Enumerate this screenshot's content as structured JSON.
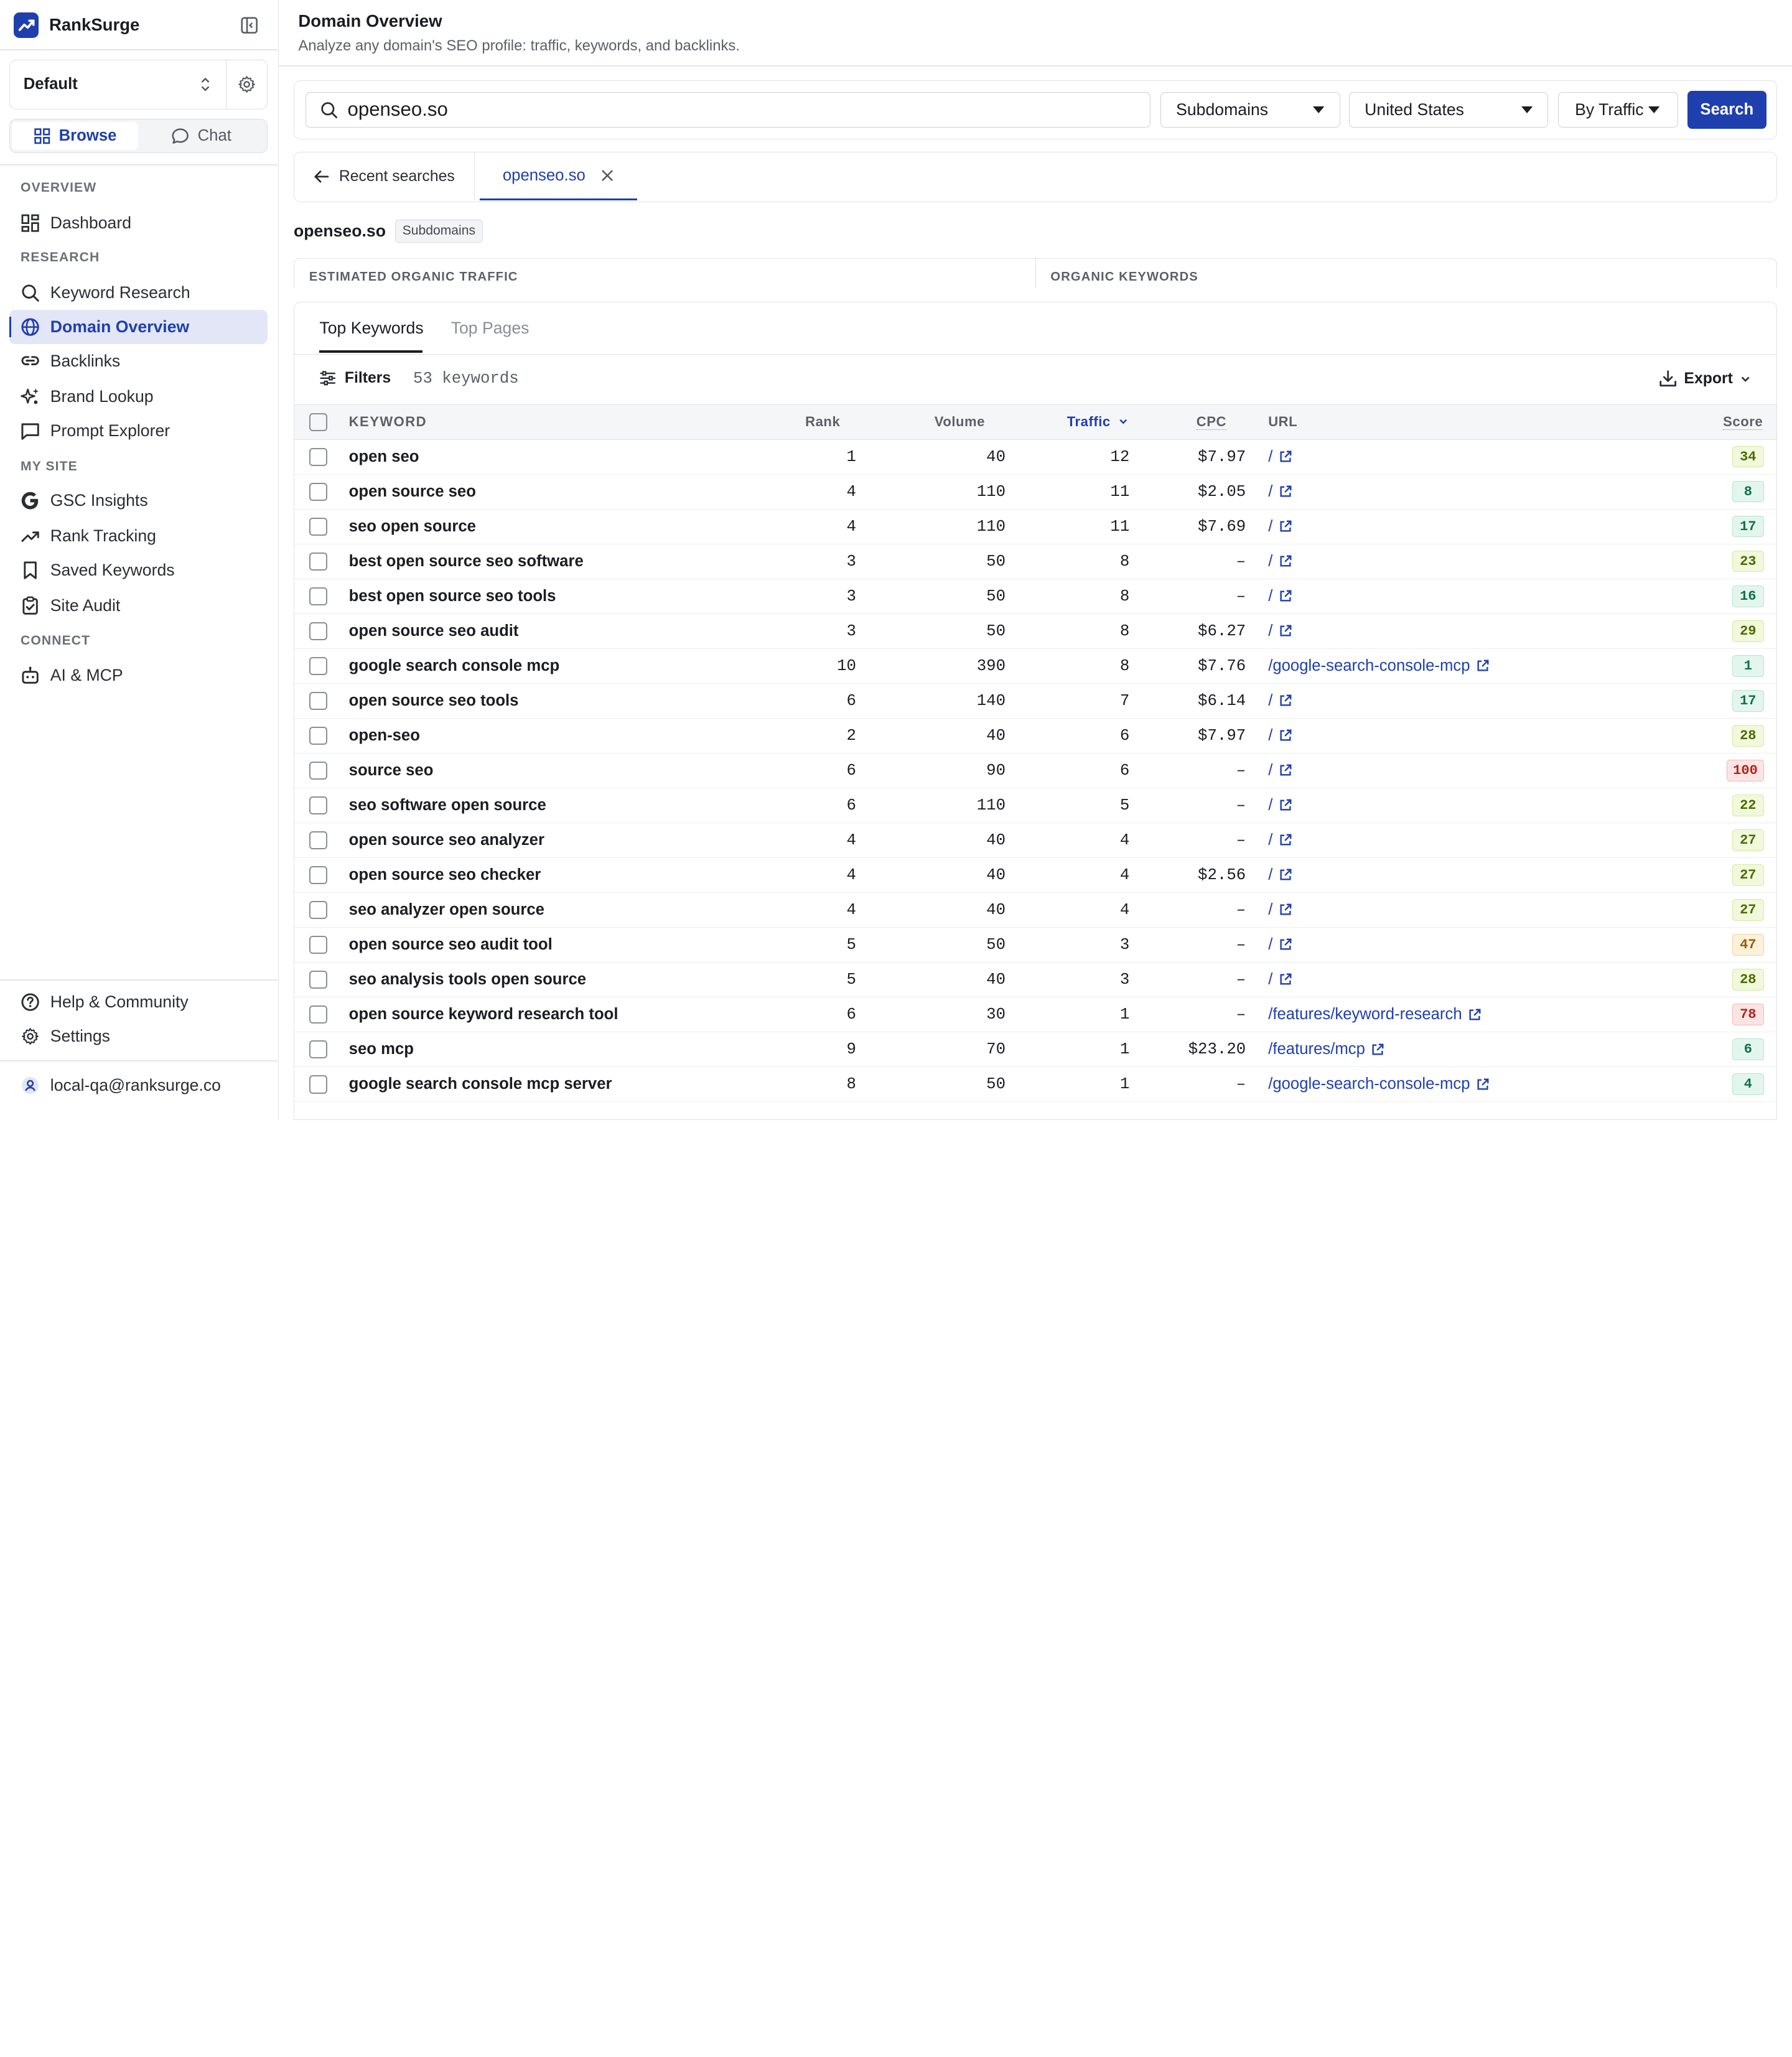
{
  "brand": {
    "name": "RankSurge"
  },
  "project": {
    "selected": "Default"
  },
  "mode_toggle": {
    "browse": "Browse",
    "chat": "Chat"
  },
  "sidebar": {
    "sections": {
      "overview": "OVERVIEW",
      "research": "RESEARCH",
      "my_site": "MY SITE",
      "connect": "CONNECT"
    },
    "items": {
      "dashboard": "Dashboard",
      "keyword_research": "Keyword Research",
      "domain_overview": "Domain Overview",
      "backlinks": "Backlinks",
      "brand_lookup": "Brand Lookup",
      "prompt_explorer": "Prompt Explorer",
      "gsc_insights": "GSC Insights",
      "rank_tracking": "Rank Tracking",
      "saved_keywords": "Saved Keywords",
      "site_audit": "Site Audit",
      "ai_mcp": "AI & MCP",
      "help": "Help & Community",
      "settings": "Settings"
    },
    "user_email": "local-qa@ranksurge.co"
  },
  "header": {
    "title": "Domain Overview",
    "subtitle": "Analyze any domain's SEO profile: traffic, keywords, and backlinks."
  },
  "search": {
    "value": "openseo.so",
    "scope": "Subdomains",
    "country": "United States",
    "sort": "By Traffic",
    "button": "Search"
  },
  "tabs": {
    "recent": "Recent searches",
    "active_domain": "openseo.so"
  },
  "domain_label": {
    "name": "openseo.so",
    "badge": "Subdomains"
  },
  "stats": {
    "traffic_label": "ESTIMATED ORGANIC TRAFFIC",
    "keywords_label": "ORGANIC KEYWORDS"
  },
  "subtabs": {
    "top_keywords": "Top Keywords",
    "top_pages": "Top Pages"
  },
  "toolbar": {
    "filters": "Filters",
    "count": "53 keywords",
    "export": "Export"
  },
  "columns": {
    "keyword": "KEYWORD",
    "rank": "Rank",
    "volume": "Volume",
    "traffic": "Traffic",
    "cpc": "CPC",
    "url": "URL",
    "score": "Score"
  },
  "colors": {
    "accent": "#1f3fae"
  },
  "rows": [
    {
      "keyword": "open seo",
      "rank": "1",
      "volume": "40",
      "traffic": "12",
      "cpc": "$7.97",
      "url": "/",
      "score": "34"
    },
    {
      "keyword": "open source seo",
      "rank": "4",
      "volume": "110",
      "traffic": "11",
      "cpc": "$2.05",
      "url": "/",
      "score": "8"
    },
    {
      "keyword": "seo open source",
      "rank": "4",
      "volume": "110",
      "traffic": "11",
      "cpc": "$7.69",
      "url": "/",
      "score": "17"
    },
    {
      "keyword": "best open source seo software",
      "rank": "3",
      "volume": "50",
      "traffic": "8",
      "cpc": "–",
      "url": "/",
      "score": "23"
    },
    {
      "keyword": "best open source seo tools",
      "rank": "3",
      "volume": "50",
      "traffic": "8",
      "cpc": "–",
      "url": "/",
      "score": "16"
    },
    {
      "keyword": "open source seo audit",
      "rank": "3",
      "volume": "50",
      "traffic": "8",
      "cpc": "$6.27",
      "url": "/",
      "score": "29"
    },
    {
      "keyword": "google search console mcp",
      "rank": "10",
      "volume": "390",
      "traffic": "8",
      "cpc": "$7.76",
      "url": "/google-search-console-mcp",
      "score": "1"
    },
    {
      "keyword": "open source seo tools",
      "rank": "6",
      "volume": "140",
      "traffic": "7",
      "cpc": "$6.14",
      "url": "/",
      "score": "17"
    },
    {
      "keyword": "open-seo",
      "rank": "2",
      "volume": "40",
      "traffic": "6",
      "cpc": "$7.97",
      "url": "/",
      "score": "28"
    },
    {
      "keyword": "source seo",
      "rank": "6",
      "volume": "90",
      "traffic": "6",
      "cpc": "–",
      "url": "/",
      "score": "100"
    },
    {
      "keyword": "seo software open source",
      "rank": "6",
      "volume": "110",
      "traffic": "5",
      "cpc": "–",
      "url": "/",
      "score": "22"
    },
    {
      "keyword": "open source seo analyzer",
      "rank": "4",
      "volume": "40",
      "traffic": "4",
      "cpc": "–",
      "url": "/",
      "score": "27"
    },
    {
      "keyword": "open source seo checker",
      "rank": "4",
      "volume": "40",
      "traffic": "4",
      "cpc": "$2.56",
      "url": "/",
      "score": "27"
    },
    {
      "keyword": "seo analyzer open source",
      "rank": "4",
      "volume": "40",
      "traffic": "4",
      "cpc": "–",
      "url": "/",
      "score": "27"
    },
    {
      "keyword": "open source seo audit tool",
      "rank": "5",
      "volume": "50",
      "traffic": "3",
      "cpc": "–",
      "url": "/",
      "score": "47"
    },
    {
      "keyword": "seo analysis tools open source",
      "rank": "5",
      "volume": "40",
      "traffic": "3",
      "cpc": "–",
      "url": "/",
      "score": "28"
    },
    {
      "keyword": "open source keyword research tool",
      "rank": "6",
      "volume": "30",
      "traffic": "1",
      "cpc": "–",
      "url": "/features/keyword-research",
      "score": "78"
    },
    {
      "keyword": "seo mcp",
      "rank": "9",
      "volume": "70",
      "traffic": "1",
      "cpc": "$23.20",
      "url": "/features/mcp",
      "score": "6"
    },
    {
      "keyword": "google search console mcp server",
      "rank": "8",
      "volume": "50",
      "traffic": "1",
      "cpc": "–",
      "url": "/google-search-console-mcp",
      "score": "4"
    }
  ]
}
